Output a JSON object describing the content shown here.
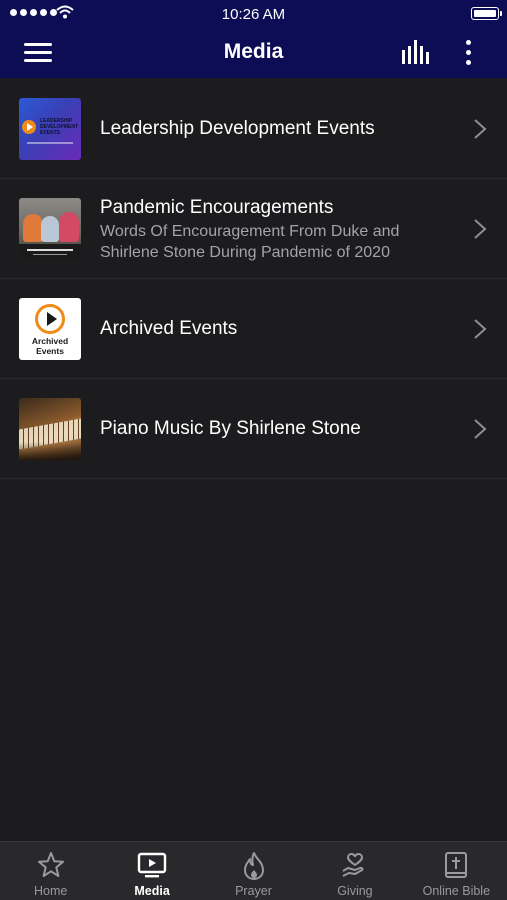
{
  "status_bar": {
    "time": "10:26 AM"
  },
  "header": {
    "title": "Media"
  },
  "list": [
    {
      "title": "Leadership Development Events",
      "subtitle": "",
      "thumb_text": "LEADERSHIP DEVELOPMENT EVENTS"
    },
    {
      "title": "Pandemic Encouragements",
      "subtitle": "Words Of Encouragement From Duke and Shirlene Stone During Pandemic of 2020",
      "thumb_text": ""
    },
    {
      "title": "Archived Events",
      "subtitle": "",
      "thumb_text": "Archived Events"
    },
    {
      "title": "Piano Music By Shirlene Stone",
      "subtitle": "",
      "thumb_text": ""
    }
  ],
  "tabs": [
    {
      "label": "Home",
      "icon": "star-icon",
      "active": false
    },
    {
      "label": "Media",
      "icon": "tv-play-icon",
      "active": true
    },
    {
      "label": "Prayer",
      "icon": "flame-icon",
      "active": false
    },
    {
      "label": "Giving",
      "icon": "hand-heart-icon",
      "active": false
    },
    {
      "label": "Online Bible",
      "icon": "bible-icon",
      "active": false
    }
  ],
  "colors": {
    "header_bg": "#0d0d55",
    "list_bg": "#1c1c1e",
    "tab_bar_bg": "#29292b",
    "accent_orange": "#f08a18"
  }
}
